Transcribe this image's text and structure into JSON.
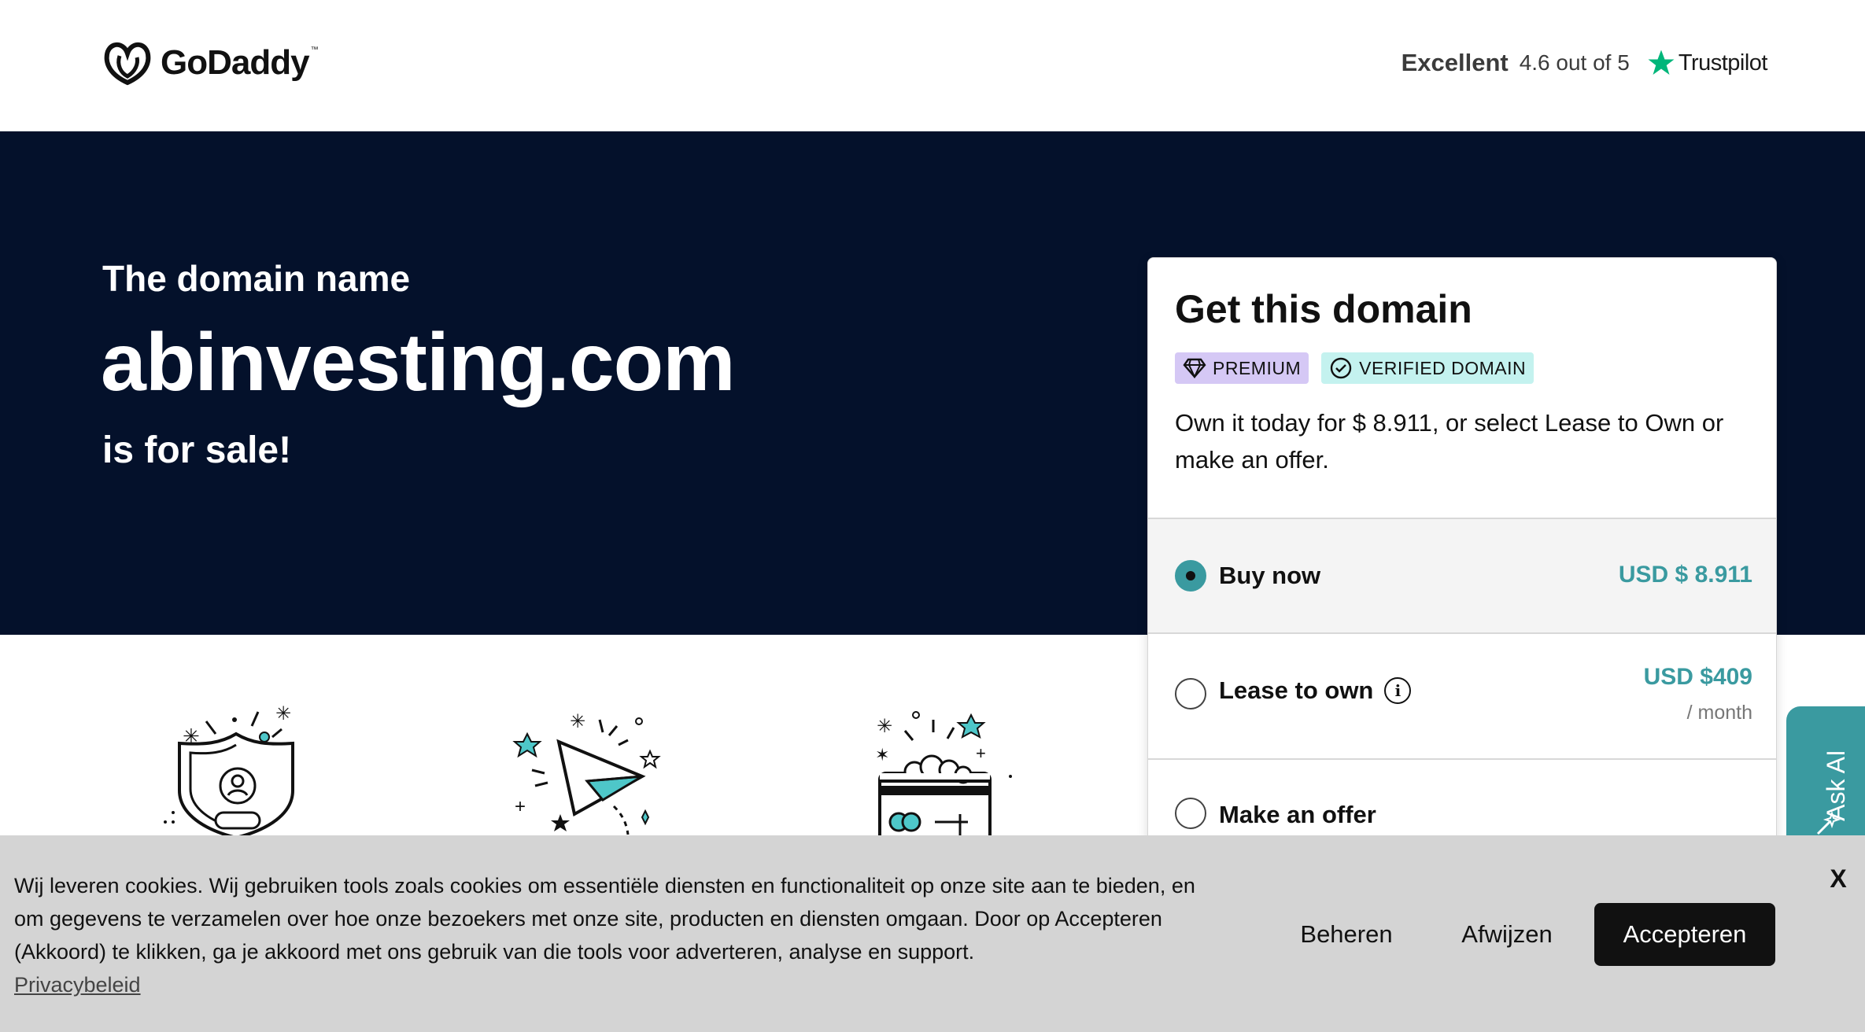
{
  "header": {
    "logo_text": "GoDaddy",
    "trustpilot": {
      "rating_word": "Excellent",
      "score": "4.6 out of 5",
      "brand": "Trustpilot"
    }
  },
  "hero": {
    "pre": "The domain name",
    "domain": "abinvesting.com",
    "post": "is for sale!"
  },
  "features": [
    {
      "icon": "shield-user-icon"
    },
    {
      "icon": "paper-plane-icon"
    },
    {
      "icon": "payment-card-icon"
    }
  ],
  "card": {
    "title": "Get this domain",
    "badges": {
      "premium": "PREMIUM",
      "verified": "VERIFIED DOMAIN"
    },
    "description": "Own it today for $ 8.911, or select Lease to Own or make an offer.",
    "options": {
      "buy": {
        "label": "Buy now",
        "price": "USD $ 8.911",
        "selected": true
      },
      "lease": {
        "label": "Lease to own",
        "price": "USD $409",
        "unit": "/ month",
        "selected": false
      },
      "offer": {
        "label": "Make an offer",
        "selected": false
      }
    }
  },
  "ask_ai": {
    "label": "Ask AI"
  },
  "cookie": {
    "text": "Wij leveren cookies. Wij gebruiken tools zoals cookies om essentiële diensten en functionaliteit op onze site aan te bieden, en om gegevens te verzamelen over hoe onze bezoekers met onze site, producten en diensten omgaan. Door op Accepteren (Akkoord) te klikken, ga je akkoord met ons gebruik van die tools voor adverteren, analyse en support.",
    "privacy_link": "Privacybeleid",
    "manage": "Beheren",
    "reject": "Afwijzen",
    "accept": "Accepteren",
    "close": "X"
  },
  "colors": {
    "hero_bg": "#04112b",
    "accent_teal": "#3a9aa0",
    "premium_badge": "#d5c8f5",
    "verified_badge": "#c4f2ef",
    "cookie_bg": "#d4d4d4",
    "trustpilot_star": "#00b67a"
  }
}
